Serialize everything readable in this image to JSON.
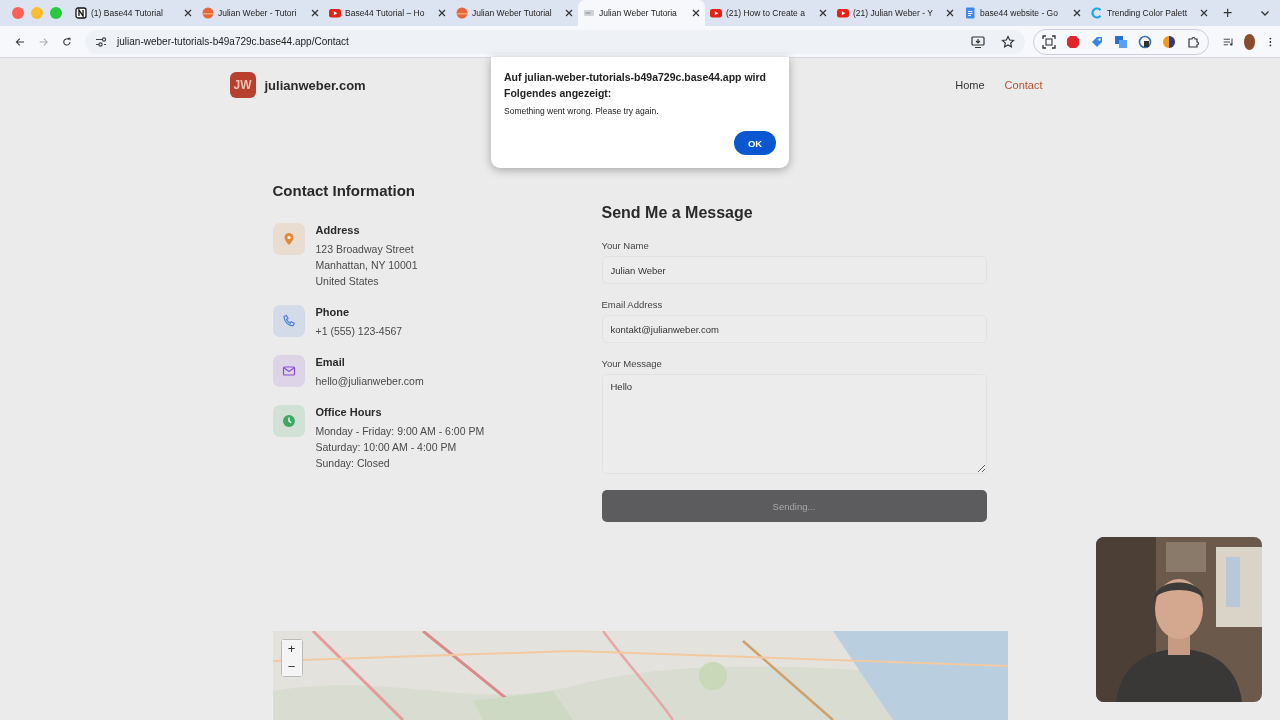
{
  "browser": {
    "tabs": [
      {
        "kind": "notion",
        "title": "(1) Base44 Tutorial",
        "selected": false
      },
      {
        "kind": "orange",
        "title": "Julian Weber - Tutori",
        "selected": false
      },
      {
        "kind": "video",
        "title": "Base44 Tutorial – Ho",
        "selected": false
      },
      {
        "kind": "orange",
        "title": "Julian Weber Tutorial",
        "selected": false
      },
      {
        "kind": "page",
        "title": "Julian Weber Tutoria",
        "selected": true
      },
      {
        "kind": "video",
        "title": "(21) How to Create a",
        "selected": false
      },
      {
        "kind": "video",
        "title": "(21) Julian Weber - Y",
        "selected": false
      },
      {
        "kind": "doc",
        "title": "base44 website - Go",
        "selected": false
      },
      {
        "kind": "ring",
        "title": "Trending Color Palett",
        "selected": false
      }
    ],
    "new_tab": "+",
    "address": "julian-weber-tutorials-b49a729c.base44.app/Contact"
  },
  "site": {
    "logo": "JW",
    "name": "julianweber.com",
    "nav": [
      {
        "label": "Home",
        "selected": false
      },
      {
        "label": "Contact",
        "selected": true
      }
    ]
  },
  "contact_info": {
    "title": "Contact Information",
    "items": [
      {
        "kind": "address",
        "color": "#e08a3c",
        "label": "Address",
        "lines": [
          "123 Broadway Street",
          "Manhattan, NY 10001",
          "United States"
        ]
      },
      {
        "kind": "phone",
        "color": "#4a7fd6",
        "label": "Phone",
        "lines": [
          "+1 (555) 123-4567"
        ]
      },
      {
        "kind": "email",
        "color": "#8a4fd0",
        "label": "Email",
        "lines": [
          "hello@julianweber.com"
        ]
      },
      {
        "kind": "hours",
        "color": "#3fa860",
        "label": "Office Hours",
        "lines": [
          "Monday - Friday: 9:00 AM - 6:00 PM",
          "Saturday: 10:00 AM - 4:00 PM",
          "Sunday: Closed"
        ]
      }
    ]
  },
  "form": {
    "title": "Send Me a Message",
    "fields": [
      {
        "kind": "input",
        "label": "Your Name",
        "value": "Julian Weber"
      },
      {
        "kind": "input",
        "label": "Email Address",
        "value": "kontakt@julianweber.com"
      },
      {
        "kind": "textarea",
        "label": "Your Message",
        "value": "Hello"
      }
    ],
    "button": {
      "label": "Sending...",
      "disabled": true
    }
  },
  "map": {
    "zoom_in": "+",
    "zoom_out": "−"
  },
  "dialog": {
    "title": "Auf julian-weber-tutorials-b49a729c.base44.app wird Folgendes angezeigt:",
    "message": "Something went wrong. Please try again.",
    "button": "OK"
  }
}
